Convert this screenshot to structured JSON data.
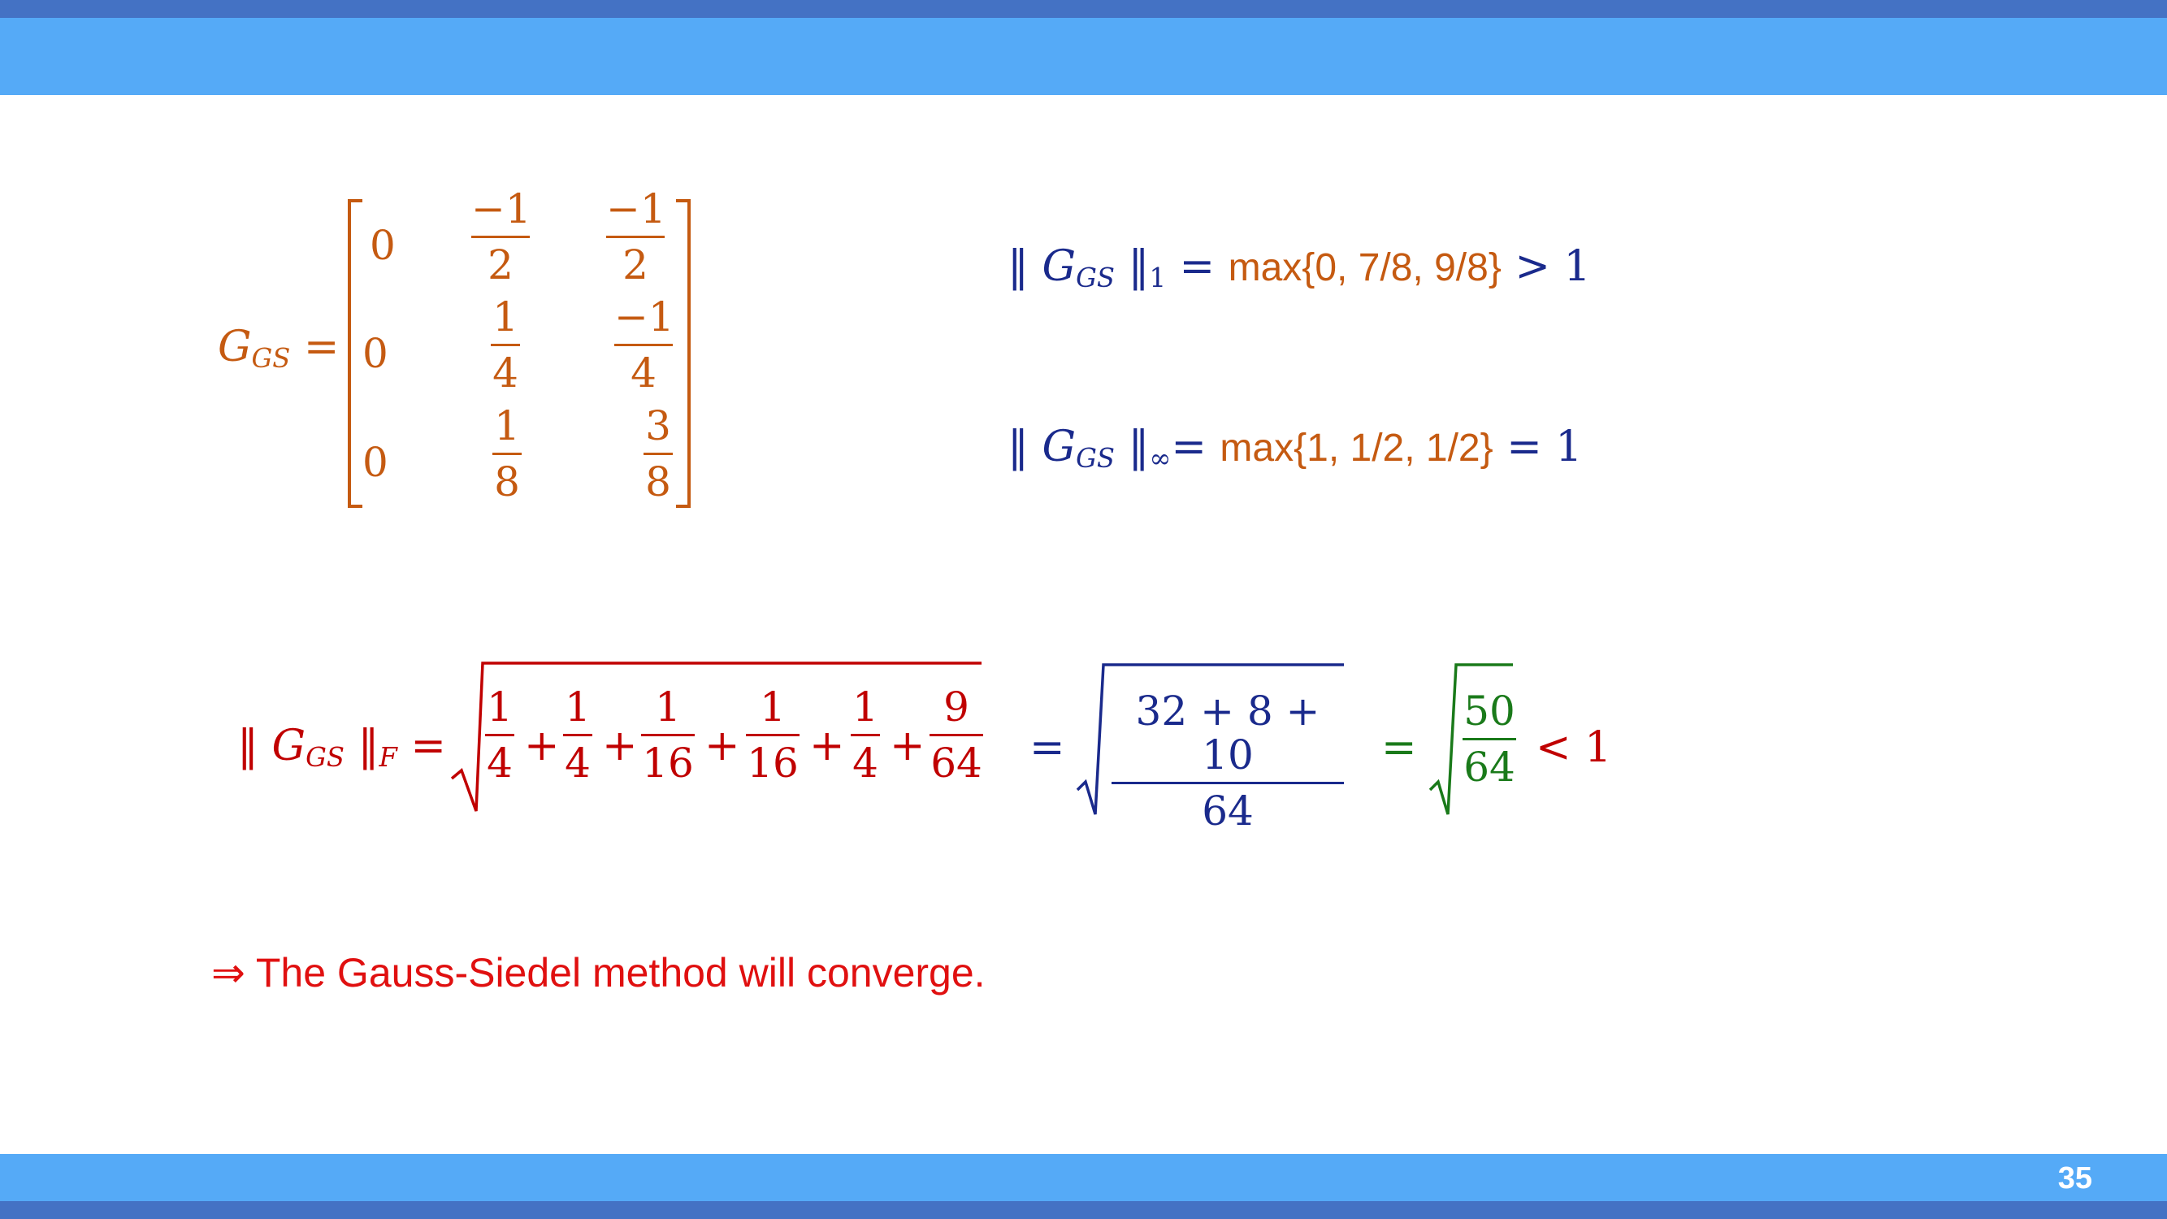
{
  "page_number": "35",
  "matrix": {
    "lhs": "G",
    "lhs_sub": "GS",
    "eq": "=",
    "rows": [
      [
        {
          "v": "0"
        },
        {
          "num": "−1",
          "den": "2"
        },
        {
          "num": "−1",
          "den": "2"
        }
      ],
      [
        {
          "v": "0"
        },
        {
          "num": "1",
          "den": "4"
        },
        {
          "num": "−1",
          "den": "4"
        }
      ],
      [
        {
          "v": "0"
        },
        {
          "num": "1",
          "den": "8"
        },
        {
          "num": "3",
          "den": "8"
        }
      ]
    ]
  },
  "norm1": {
    "bars_open": "‖",
    "g": "G",
    "g_sub": "GS",
    "bars_close": "‖",
    "sub": "1",
    "eq": "=",
    "expr": "max{0, 7/8, 9/8}",
    "result": "> 1"
  },
  "norminf": {
    "bars_open": "‖",
    "g": "G",
    "g_sub": "GS",
    "bars_close": "‖",
    "sub": "∞",
    "eq": "=",
    "expr": "max{1, 1/2,  1/2}",
    "result": "=  1"
  },
  "frobenius": {
    "bars_open": "‖",
    "g": "G",
    "g_sub": "GS",
    "bars_close": "‖",
    "sub": "F",
    "eq": "=",
    "terms": [
      {
        "num": "1",
        "den": "4"
      },
      {
        "num": "1",
        "den": "4"
      },
      {
        "num": "1",
        "den": "16"
      },
      {
        "num": "1",
        "den": "16"
      },
      {
        "num": "1",
        "den": "4"
      },
      {
        "num": "9",
        "den": "64"
      }
    ],
    "plus": "+",
    "step2_eq": "=",
    "step2_num": "32 + 8 + 10",
    "step2_den": "64",
    "step3_eq": "=",
    "step3_num": "50",
    "step3_den": "64",
    "result": "< 1"
  },
  "conclusion": "⇒ The Gauss-Siedel method will converge."
}
